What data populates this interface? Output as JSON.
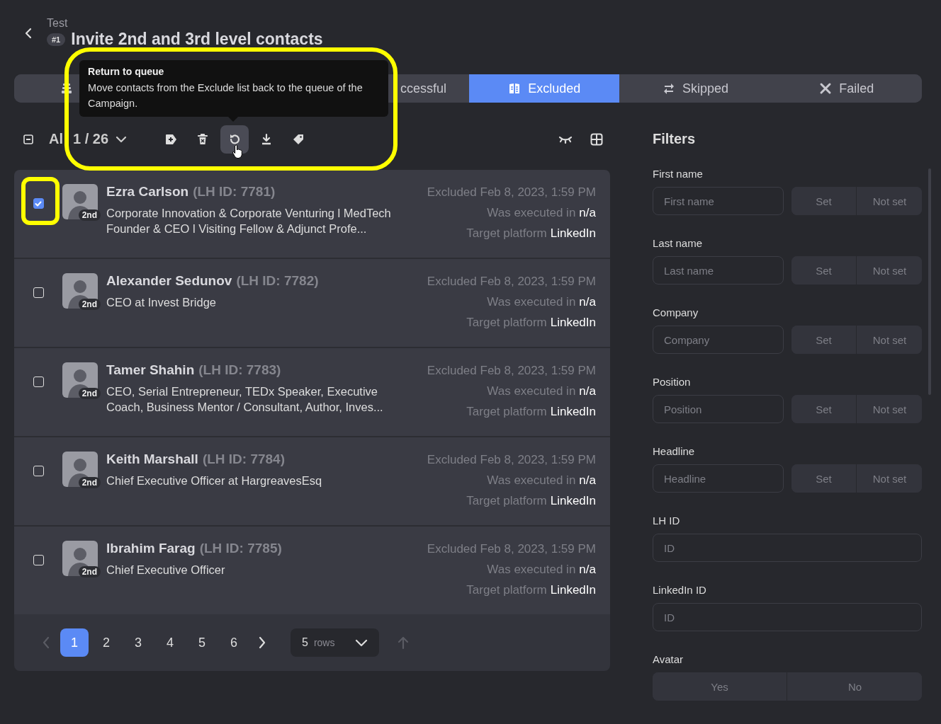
{
  "header": {
    "subtitle": "Test",
    "badge": "#1",
    "title": "Invite 2nd and 3rd level contacts"
  },
  "tabs": [
    {
      "kind": "queue",
      "selected": false
    },
    {
      "kind": "successful",
      "label": "ccessful",
      "selected": false
    },
    {
      "kind": "excluded",
      "label": "Excluded",
      "selected": true
    },
    {
      "kind": "skipped",
      "label": "Skipped",
      "selected": false
    },
    {
      "kind": "failed",
      "label": "Failed",
      "selected": false
    }
  ],
  "toolbar": {
    "select_all_indeterminate": true,
    "select_label": "Al",
    "count": "1 / 26",
    "highlighted": true,
    "actions": [
      {
        "kind": "add-tag",
        "hovered": false
      },
      {
        "kind": "delete",
        "hovered": false
      },
      {
        "kind": "return",
        "hovered": true
      },
      {
        "kind": "download",
        "hovered": false
      },
      {
        "kind": "tag",
        "hovered": false
      }
    ],
    "tooltip": {
      "title": "Return to queue",
      "text": "Move contacts from the Exclude list back to the queue of the Campaign."
    }
  },
  "rows": [
    {
      "name": "Ezra Carlson",
      "lh_id": "(LH ID: 7781)",
      "degree": "2nd",
      "headline": "Corporate Innovation & Corporate Venturing l MedTech Founder & CEO l Visiting Fellow & Adjunct Profe...",
      "excluded": "Excluded Feb 8, 2023, 1:59 PM",
      "executed_label": "Was executed in",
      "executed_value": "n/a",
      "platform_label": "Target platform",
      "platform_value": "LinkedIn",
      "checked": true,
      "highlighted": true
    },
    {
      "name": "Alexander Sedunov",
      "lh_id": "(LH ID: 7782)",
      "degree": "2nd",
      "headline": "CEO at Invest Bridge",
      "excluded": "Excluded Feb 8, 2023, 1:59 PM",
      "executed_label": "Was executed in",
      "executed_value": "n/a",
      "platform_label": "Target platform",
      "platform_value": "LinkedIn",
      "checked": false,
      "highlighted": false
    },
    {
      "name": "Tamer Shahin",
      "lh_id": "(LH ID: 7783)",
      "degree": "2nd",
      "headline": "CEO, Serial Entrepreneur, TEDx Speaker, Executive Coach, Business Mentor / Consultant, Author, Inves...",
      "excluded": "Excluded Feb 8, 2023, 1:59 PM",
      "executed_label": "Was executed in",
      "executed_value": "n/a",
      "platform_label": "Target platform",
      "platform_value": "LinkedIn",
      "checked": false,
      "highlighted": false
    },
    {
      "name": "Keith Marshall",
      "lh_id": "(LH ID: 7784)",
      "degree": "2nd",
      "headline": "Chief Executive Officer at HargreavesEsq",
      "excluded": "Excluded Feb 8, 2023, 1:59 PM",
      "executed_label": "Was executed in",
      "executed_value": "n/a",
      "platform_label": "Target platform",
      "platform_value": "LinkedIn",
      "checked": false,
      "highlighted": false
    },
    {
      "name": "Ibrahim Farag",
      "lh_id": "(LH ID: 7785)",
      "degree": "2nd",
      "headline": "Chief Executive Officer",
      "excluded": "Excluded Feb 8, 2023, 1:59 PM",
      "executed_label": "Was executed in",
      "executed_value": "n/a",
      "platform_label": "Target platform",
      "platform_value": "LinkedIn",
      "checked": false,
      "highlighted": false
    }
  ],
  "pagination": {
    "prev_disabled": true,
    "pages": [
      {
        "label": "1",
        "selected": true
      },
      {
        "label": "2",
        "selected": false
      },
      {
        "label": "3",
        "selected": false
      },
      {
        "label": "4",
        "selected": false
      },
      {
        "label": "5",
        "selected": false
      },
      {
        "label": "6",
        "selected": false
      }
    ],
    "rows_value": "5",
    "rows_unit": "rows"
  },
  "filters": {
    "title": "Filters",
    "items": [
      {
        "kind": "set",
        "label": "First name",
        "placeholder": "First name",
        "set": "Set",
        "not_set": "Not set"
      },
      {
        "kind": "set",
        "label": "Last name",
        "placeholder": "Last name",
        "set": "Set",
        "not_set": "Not set"
      },
      {
        "kind": "set",
        "label": "Company",
        "placeholder": "Company",
        "set": "Set",
        "not_set": "Not set"
      },
      {
        "kind": "set",
        "label": "Position",
        "placeholder": "Position",
        "set": "Set",
        "not_set": "Not set"
      },
      {
        "kind": "set",
        "label": "Headline",
        "placeholder": "Headline",
        "set": "Set",
        "not_set": "Not set"
      },
      {
        "kind": "text",
        "label": "LH ID",
        "placeholder": "ID"
      },
      {
        "kind": "text",
        "label": "LinkedIn ID",
        "placeholder": "ID"
      },
      {
        "kind": "toggle",
        "label": "Avatar",
        "options": [
          "Yes",
          "No"
        ]
      }
    ]
  }
}
